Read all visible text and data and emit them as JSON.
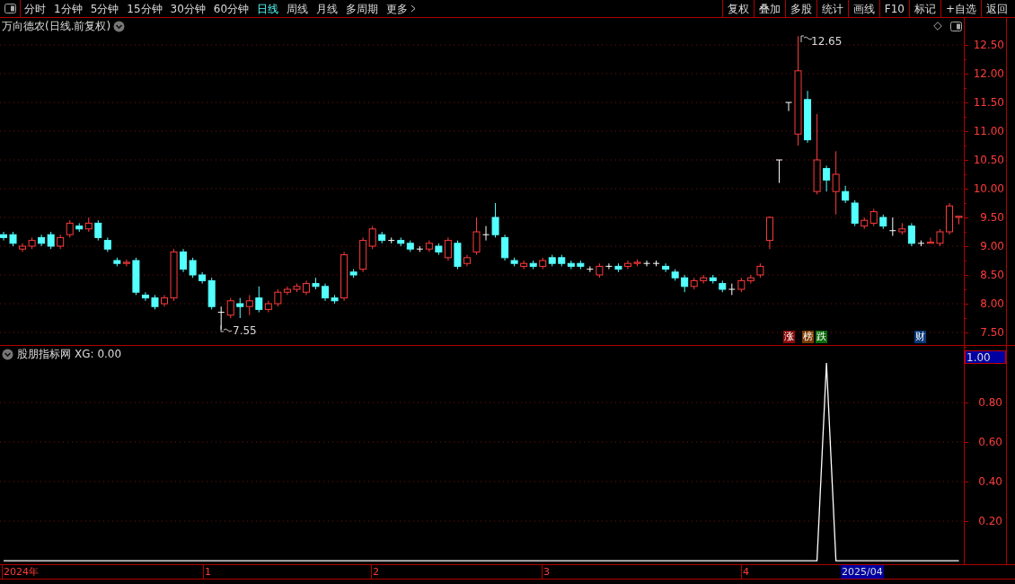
{
  "toolbar": {
    "periods": [
      {
        "label": "分时",
        "selected": false
      },
      {
        "label": "1分钟",
        "selected": false
      },
      {
        "label": "5分钟",
        "selected": false
      },
      {
        "label": "15分钟",
        "selected": false
      },
      {
        "label": "30分钟",
        "selected": false
      },
      {
        "label": "60分钟",
        "selected": false
      },
      {
        "label": "日线",
        "selected": true
      },
      {
        "label": "周线",
        "selected": false
      },
      {
        "label": "月线",
        "selected": false
      },
      {
        "label": "多周期",
        "selected": false
      },
      {
        "label": "更多",
        "selected": false
      }
    ],
    "buttons": [
      "复权",
      "叠加",
      "多股",
      "统计",
      "画线",
      "F10",
      "标记",
      "+自选",
      "返回"
    ]
  },
  "price_chart": {
    "title": "万向德农(日线.前复权)",
    "high_marker": "12.65",
    "low_marker": "7.55",
    "badges": [
      {
        "label": "涨",
        "color": "#8b0a0a"
      },
      {
        "label": "榜",
        "color": "#7a3a00"
      },
      {
        "label": "跌",
        "color": "#0a6a0a"
      },
      {
        "label": "财",
        "color": "#0a3a78"
      }
    ],
    "chart_data": {
      "type": "candlestick",
      "grid": true,
      "ylim": [
        7.5,
        12.5
      ],
      "yticks": [
        {
          "value": 12.5,
          "label": "12.50"
        },
        {
          "value": 12,
          "label": "12.00"
        },
        {
          "value": 11.5,
          "label": "11.50"
        },
        {
          "value": 11,
          "label": "11.00"
        },
        {
          "value": 10.5,
          "label": "10.50"
        },
        {
          "value": 10,
          "label": "10.00"
        },
        {
          "value": 9.5,
          "label": "9.50"
        },
        {
          "value": 9,
          "label": "9.00"
        },
        {
          "value": 8.5,
          "label": "8.50"
        },
        {
          "value": 8,
          "label": "8.00"
        },
        {
          "value": 7.5,
          "label": "7.50"
        }
      ],
      "ohlc": [
        [
          9.2,
          9.25,
          9.1,
          9.15
        ],
        [
          9.2,
          9.25,
          9.0,
          9.05
        ],
        [
          8.95,
          9.05,
          8.9,
          9.0
        ],
        [
          9.0,
          9.15,
          8.95,
          9.1
        ],
        [
          9.15,
          9.2,
          9.0,
          9.05
        ],
        [
          9.2,
          9.25,
          8.95,
          9.0
        ],
        [
          9.0,
          9.2,
          8.95,
          9.15
        ],
        [
          9.2,
          9.45,
          9.15,
          9.4
        ],
        [
          9.35,
          9.4,
          9.25,
          9.3
        ],
        [
          9.3,
          9.5,
          9.25,
          9.4
        ],
        [
          9.4,
          9.45,
          9.1,
          9.15
        ],
        [
          9.1,
          9.15,
          8.9,
          8.95
        ],
        [
          8.75,
          8.8,
          8.65,
          8.7
        ],
        [
          8.7,
          8.77,
          8.65,
          8.72
        ],
        [
          8.75,
          8.8,
          8.15,
          8.2
        ],
        [
          8.15,
          8.2,
          8.05,
          8.1
        ],
        [
          8.1,
          8.15,
          7.9,
          7.95
        ],
        [
          8.0,
          8.15,
          7.95,
          8.1
        ],
        [
          8.1,
          8.95,
          8.05,
          8.9
        ],
        [
          8.9,
          8.95,
          8.55,
          8.6
        ],
        [
          8.75,
          8.8,
          8.45,
          8.5
        ],
        [
          8.5,
          8.55,
          8.35,
          8.4
        ],
        [
          8.4,
          8.45,
          7.9,
          7.95
        ],
        [
          7.85,
          7.95,
          7.55,
          7.85
        ],
        [
          7.8,
          8.1,
          7.75,
          8.05
        ],
        [
          8.0,
          8.1,
          7.75,
          7.95
        ],
        [
          7.95,
          8.15,
          7.8,
          8.05
        ],
        [
          8.1,
          8.3,
          7.85,
          7.9
        ],
        [
          7.9,
          8.05,
          7.85,
          8.0
        ],
        [
          8.0,
          8.25,
          7.95,
          8.2
        ],
        [
          8.2,
          8.3,
          8.15,
          8.25
        ],
        [
          8.25,
          8.35,
          8.2,
          8.3
        ],
        [
          8.2,
          8.4,
          8.15,
          8.35
        ],
        [
          8.35,
          8.45,
          8.25,
          8.3
        ],
        [
          8.3,
          8.35,
          8.05,
          8.1
        ],
        [
          8.1,
          8.15,
          8.0,
          8.05
        ],
        [
          8.1,
          8.9,
          8.05,
          8.85
        ],
        [
          8.55,
          8.6,
          8.45,
          8.5
        ],
        [
          8.6,
          9.15,
          8.55,
          9.1
        ],
        [
          9.0,
          9.35,
          8.95,
          9.3
        ],
        [
          9.2,
          9.25,
          9.05,
          9.1
        ],
        [
          9.1,
          9.15,
          9.05,
          9.1
        ],
        [
          9.1,
          9.15,
          9.0,
          9.05
        ],
        [
          9.05,
          9.1,
          8.9,
          8.95
        ],
        [
          8.95,
          9.0,
          8.9,
          8.95
        ],
        [
          8.95,
          9.1,
          8.9,
          9.05
        ],
        [
          9.0,
          9.05,
          8.85,
          8.9
        ],
        [
          8.8,
          9.15,
          8.75,
          9.1
        ],
        [
          9.05,
          9.1,
          8.6,
          8.65
        ],
        [
          8.7,
          8.85,
          8.65,
          8.8
        ],
        [
          8.9,
          9.5,
          8.85,
          9.25
        ],
        [
          9.2,
          9.35,
          9.1,
          9.2
        ],
        [
          9.5,
          9.75,
          9.15,
          9.2
        ],
        [
          9.15,
          9.2,
          8.75,
          8.8
        ],
        [
          8.75,
          8.8,
          8.65,
          8.7
        ],
        [
          8.65,
          8.75,
          8.6,
          8.7
        ],
        [
          8.7,
          8.75,
          8.6,
          8.65
        ],
        [
          8.65,
          8.8,
          8.6,
          8.75
        ],
        [
          8.8,
          8.85,
          8.65,
          8.7
        ],
        [
          8.8,
          8.85,
          8.65,
          8.7
        ],
        [
          8.7,
          8.75,
          8.6,
          8.65
        ],
        [
          8.7,
          8.75,
          8.6,
          8.65
        ],
        [
          8.6,
          8.65,
          8.55,
          8.6
        ],
        [
          8.5,
          8.7,
          8.45,
          8.65
        ],
        [
          8.65,
          8.7,
          8.6,
          8.65
        ],
        [
          8.65,
          8.7,
          8.55,
          8.6
        ],
        [
          8.65,
          8.75,
          8.6,
          8.7
        ],
        [
          8.7,
          8.77,
          8.65,
          8.72
        ],
        [
          8.7,
          8.75,
          8.65,
          8.7
        ],
        [
          8.7,
          8.75,
          8.65,
          8.7
        ],
        [
          8.65,
          8.7,
          8.55,
          8.6
        ],
        [
          8.55,
          8.6,
          8.4,
          8.45
        ],
        [
          8.45,
          8.5,
          8.2,
          8.3
        ],
        [
          8.3,
          8.45,
          8.25,
          8.4
        ],
        [
          8.4,
          8.5,
          8.35,
          8.45
        ],
        [
          8.45,
          8.5,
          8.35,
          8.4
        ],
        [
          8.35,
          8.4,
          8.2,
          8.25
        ],
        [
          8.25,
          8.35,
          8.15,
          8.25
        ],
        [
          8.25,
          8.45,
          8.2,
          8.4
        ],
        [
          8.4,
          8.5,
          8.35,
          8.45
        ],
        [
          8.5,
          8.7,
          8.45,
          8.65
        ],
        [
          9.1,
          9.52,
          8.95,
          9.5
        ],
        [
          10.5,
          10.5,
          10.1,
          10.5
        ],
        [
          11.5,
          11.5,
          11.35,
          11.5
        ],
        [
          10.95,
          12.65,
          10.75,
          12.05
        ],
        [
          11.55,
          11.7,
          10.8,
          10.85
        ],
        [
          9.95,
          11.3,
          9.9,
          10.5
        ],
        [
          10.35,
          10.4,
          9.95,
          10.15
        ],
        [
          9.95,
          10.65,
          9.55,
          10.25
        ],
        [
          9.95,
          10.05,
          9.75,
          9.8
        ],
        [
          9.75,
          9.8,
          9.35,
          9.4
        ],
        [
          9.35,
          9.5,
          9.3,
          9.45
        ],
        [
          9.4,
          9.65,
          9.35,
          9.6
        ],
        [
          9.5,
          9.55,
          9.3,
          9.35
        ],
        [
          9.27,
          9.5,
          9.18,
          9.27
        ],
        [
          9.25,
          9.4,
          9.2,
          9.3
        ],
        [
          9.35,
          9.4,
          9.0,
          9.05
        ],
        [
          9.05,
          9.1,
          9.0,
          9.05
        ],
        [
          9.05,
          9.15,
          9.05,
          9.07
        ],
        [
          9.05,
          9.3,
          9.0,
          9.25
        ],
        [
          9.25,
          9.75,
          9.2,
          9.7
        ],
        [
          9.5,
          9.52,
          9.38,
          9.52
        ]
      ]
    }
  },
  "indicator": {
    "title": "股朋指标网",
    "reading": ": 0.00",
    "current_value": "1.00",
    "chart_data": {
      "type": "line",
      "grid": true,
      "ylim": [
        -0.018,
        1.086
      ],
      "yticks": [
        {
          "value": 0.2,
          "label": "0.20"
        },
        {
          "value": 0.4,
          "label": "0.40"
        },
        {
          "value": 0.6,
          "label": "0.60"
        },
        {
          "value": 0.8,
          "label": "0.80"
        }
      ],
      "series": [
        {
          "name": "XG",
          "color": "#ffffff",
          "values": [
            0,
            0,
            0,
            0,
            0,
            0,
            0,
            0,
            0,
            0,
            0,
            0,
            0,
            0,
            0,
            0,
            0,
            0,
            0,
            0,
            0,
            0,
            0,
            0,
            0,
            0,
            0,
            0,
            0,
            0,
            0,
            0,
            0,
            0,
            0,
            0,
            0,
            0,
            0,
            0,
            0,
            0,
            0,
            0,
            0,
            0,
            0,
            0,
            0,
            0,
            0,
            0,
            0,
            0,
            0,
            0,
            0,
            0,
            0,
            0,
            0,
            0,
            0,
            0,
            0,
            0,
            0,
            0,
            0,
            0,
            0,
            0,
            0,
            0,
            0,
            0,
            0,
            0,
            0,
            0,
            0,
            0,
            0,
            0,
            0,
            0,
            0,
            1,
            0,
            0,
            0,
            0,
            0,
            0,
            0,
            0,
            0,
            0,
            0,
            0,
            0,
            0
          ]
        }
      ]
    }
  },
  "date_axis": {
    "labels": [
      "2024年",
      "1",
      "2",
      "3",
      "4"
    ],
    "cursor_date": "2025/04"
  }
}
